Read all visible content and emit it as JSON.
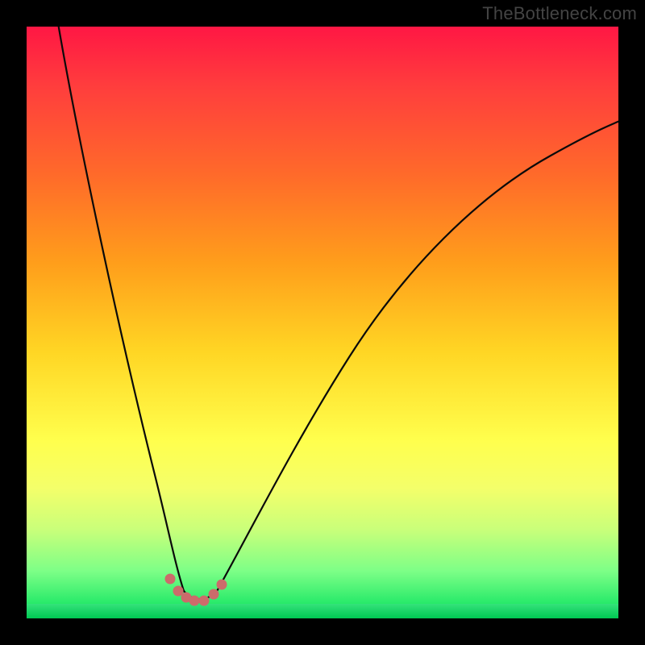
{
  "watermark": "TheBottleneck.com",
  "chart_data": {
    "type": "line",
    "title": "",
    "xlabel": "",
    "ylabel": "",
    "xlim": [
      0,
      100
    ],
    "ylim": [
      0,
      100
    ],
    "note": "V-shaped curve with minimum near x≈27; left branch starts near top-left and descends steeply; right branch rises from the dip and saturates toward upper-right. Approximate values read from plot-area pixels mapped to 0–100 range on both axes.",
    "series": [
      {
        "name": "curve",
        "x": [
          5,
          8,
          12,
          16,
          20,
          24,
          26,
          28,
          30,
          34,
          40,
          48,
          56,
          64,
          72,
          80,
          88,
          96,
          100
        ],
        "y": [
          100,
          90,
          77,
          62,
          45,
          20,
          6,
          4,
          5,
          12,
          25,
          40,
          52,
          61,
          68,
          74,
          78,
          82,
          84
        ]
      },
      {
        "name": "dip-markers",
        "type": "scatter",
        "x": [
          23.5,
          24.5,
          25.5,
          26.5,
          28.0,
          29.5,
          30.5
        ],
        "y": [
          7.0,
          5.0,
          4.2,
          3.8,
          3.8,
          5.0,
          6.8
        ]
      }
    ],
    "background_gradient": [
      "#ff1744",
      "#ff6a2a",
      "#ffd624",
      "#ffff4d",
      "#00e05c"
    ]
  }
}
